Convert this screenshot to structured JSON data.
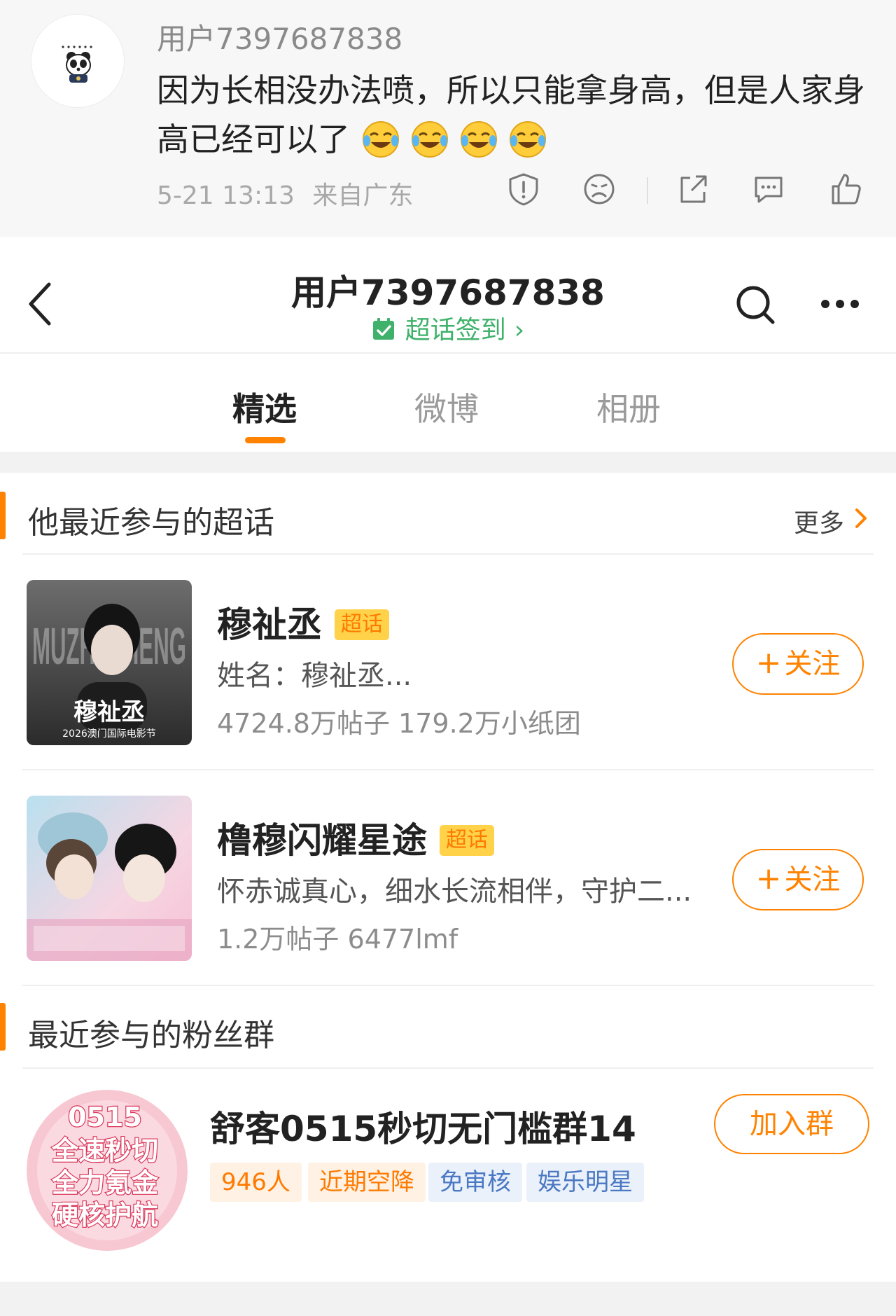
{
  "comment": {
    "username": "用户7397687838",
    "text": "因为长相没办法喷，所以只能拿身高，但是人家身高已经可以了",
    "emojis": [
      "laugh-cry-emoji",
      "laugh-cry-emoji",
      "laugh-cry-emoji",
      "laugh-cry-emoji"
    ],
    "time": "5-21 13:13",
    "source": "来自广东",
    "actions": [
      "report-icon",
      "dislike-icon",
      "share-icon",
      "comment-icon",
      "like-icon"
    ]
  },
  "profile": {
    "title": "用户7397687838",
    "checkin_label": "超话签到",
    "checkin_arrow": "›"
  },
  "tabs": [
    {
      "label": "精选",
      "active": true
    },
    {
      "label": "微博",
      "active": false
    },
    {
      "label": "相册",
      "active": false
    }
  ],
  "supertopics": {
    "title": "他最近参与的超话",
    "more_label": "更多",
    "items": [
      {
        "name": "穆祉丞",
        "badge": "超话",
        "desc": "姓名：穆祉丞...",
        "stats": "4724.8万帖子 179.2万小纸团",
        "follow_plus": "+",
        "follow_label": "关注",
        "thumb_caption": "穆祉丞",
        "thumb_sub": "2026澳门国际电影节",
        "thumb_big": "MUZHI CHENG"
      },
      {
        "name": "橹穆闪耀星途",
        "badge": "超话",
        "desc": "怀赤诚真心，细水长流相伴，守护二...",
        "stats": "1.2万帖子 6477lmf",
        "follow_plus": "+",
        "follow_label": "关注"
      }
    ]
  },
  "fangroups": {
    "title": "最近参与的粉丝群",
    "items": [
      {
        "name": "舒客0515秒切无门槛群14",
        "join_label": "加入群",
        "avatar_lines": [
          "0515",
          "全速秒切",
          "全力氪金",
          "硬核护航"
        ],
        "tags": [
          {
            "text": "946人",
            "style": "orange"
          },
          {
            "text": "近期空降",
            "style": "orange"
          },
          {
            "text": "免审核",
            "style": "blue"
          },
          {
            "text": "娱乐明星",
            "style": "blue"
          }
        ]
      }
    ]
  },
  "colors": {
    "accent": "#ff8200",
    "checkin_green": "#3fb16a",
    "badge_bg": "#ffd24a",
    "tag_blue": "#4a78c2"
  }
}
